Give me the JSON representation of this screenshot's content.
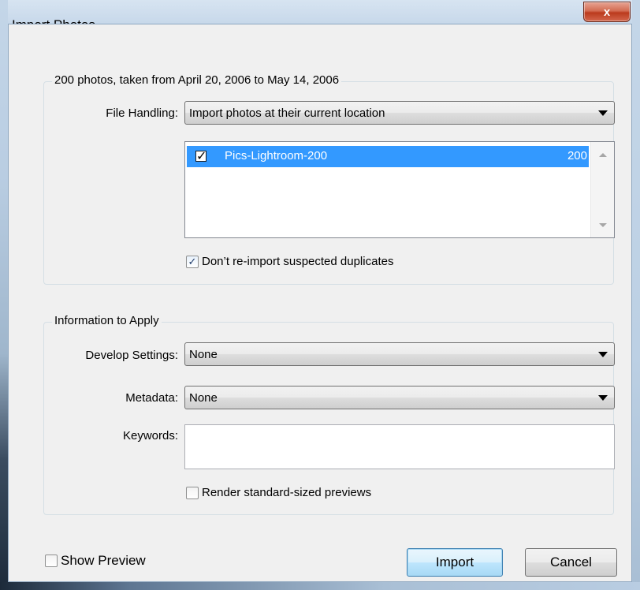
{
  "window": {
    "title": "Import Photos",
    "close_symbol": "x"
  },
  "source_group": {
    "legend": "200 photos, taken from April 20, 2006 to May 14, 2006",
    "file_handling_label": "File Handling:",
    "file_handling_value": "Import photos at their current location",
    "folders": [
      {
        "name": "Pics-Lightroom-200",
        "count": "200",
        "checked": true
      }
    ],
    "no_duplicates_label": "Don’t re-import suspected duplicates",
    "no_duplicates_checked": true
  },
  "info_group": {
    "legend": "Information to Apply",
    "develop_label": "Develop Settings:",
    "develop_value": "None",
    "metadata_label": "Metadata:",
    "metadata_value": "None",
    "keywords_label": "Keywords:",
    "keywords_value": "",
    "render_previews_label": "Render standard-sized previews",
    "render_previews_checked": false
  },
  "footer": {
    "show_preview_label": "Show Preview",
    "show_preview_checked": false,
    "import_label": "Import",
    "cancel_label": "Cancel"
  },
  "colors": {
    "selection": "#3399ff",
    "close_button": "#c8472a",
    "frame": "#bcd0e4"
  },
  "icons": [
    "close-icon",
    "dropdown-arrow-icon",
    "scroll-up-icon",
    "scroll-down-icon",
    "checkmark-icon"
  ]
}
